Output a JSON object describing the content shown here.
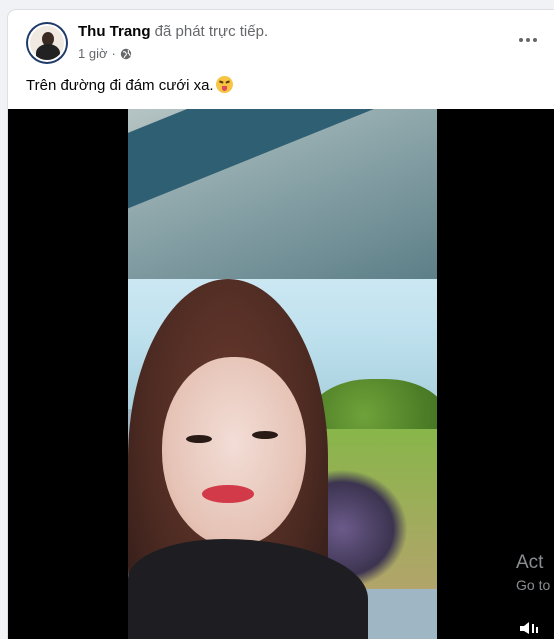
{
  "post": {
    "author": "Thu Trang",
    "action": "đã phát trực tiếp.",
    "time": "1 giờ",
    "separator": "·",
    "privacy_icon": "globe-icon",
    "more_icon": "more-horizontal-icon",
    "caption": "Trên đường đi đám cưới xa.",
    "caption_emoji": "squinting-face-with-tongue-emoji"
  },
  "overlay": {
    "activate_title": "Act",
    "activate_sub": "Go to"
  },
  "colors": {
    "author_text": "#050505",
    "secondary_text": "#65676b",
    "card_bg": "#ffffff",
    "page_bg": "#f0f2f5",
    "video_bg": "#000000"
  }
}
